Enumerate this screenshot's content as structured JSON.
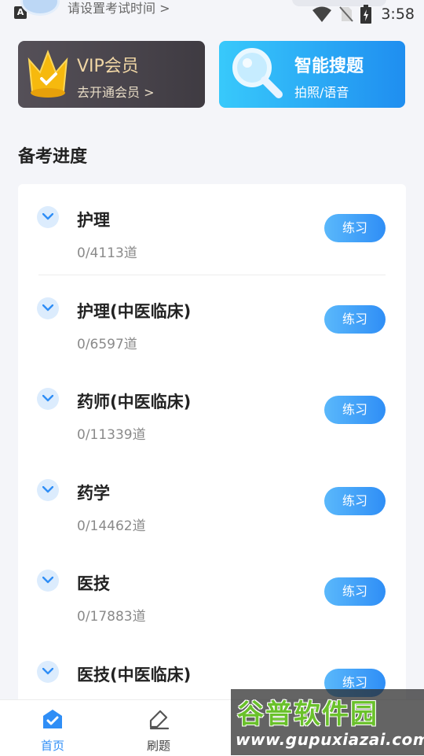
{
  "status_bar": {
    "time": "3:58"
  },
  "header": {
    "exam_time_link": "请设置考试时间 >"
  },
  "promo": {
    "vip": {
      "title": "VIP会员",
      "subtitle": "去开通会员 >"
    },
    "search": {
      "title": "智能搜题",
      "subtitle": "拍照/语音"
    }
  },
  "progress": {
    "title": "备考进度",
    "items": [
      {
        "name": "护理",
        "count": "0/4113道",
        "button": "练习"
      },
      {
        "name": "护理(中医临床)",
        "count": "0/6597道",
        "button": "练习"
      },
      {
        "name": "药师(中医临床)",
        "count": "0/11339道",
        "button": "练习"
      },
      {
        "name": "药学",
        "count": "0/14462道",
        "button": "练习"
      },
      {
        "name": "医技",
        "count": "0/17883道",
        "button": "练习"
      },
      {
        "name": "医技(中医临床)",
        "count": "",
        "button": "练习"
      }
    ]
  },
  "bottom_nav": {
    "home": "首页",
    "practice": "刷题"
  },
  "watermark": {
    "title": "谷普软件园",
    "url": "www.gupuxiazai.com"
  },
  "colors": {
    "accent": "#2f8ef6",
    "vip_gold": "#f0d6a5",
    "background": "#f4f5f9"
  }
}
